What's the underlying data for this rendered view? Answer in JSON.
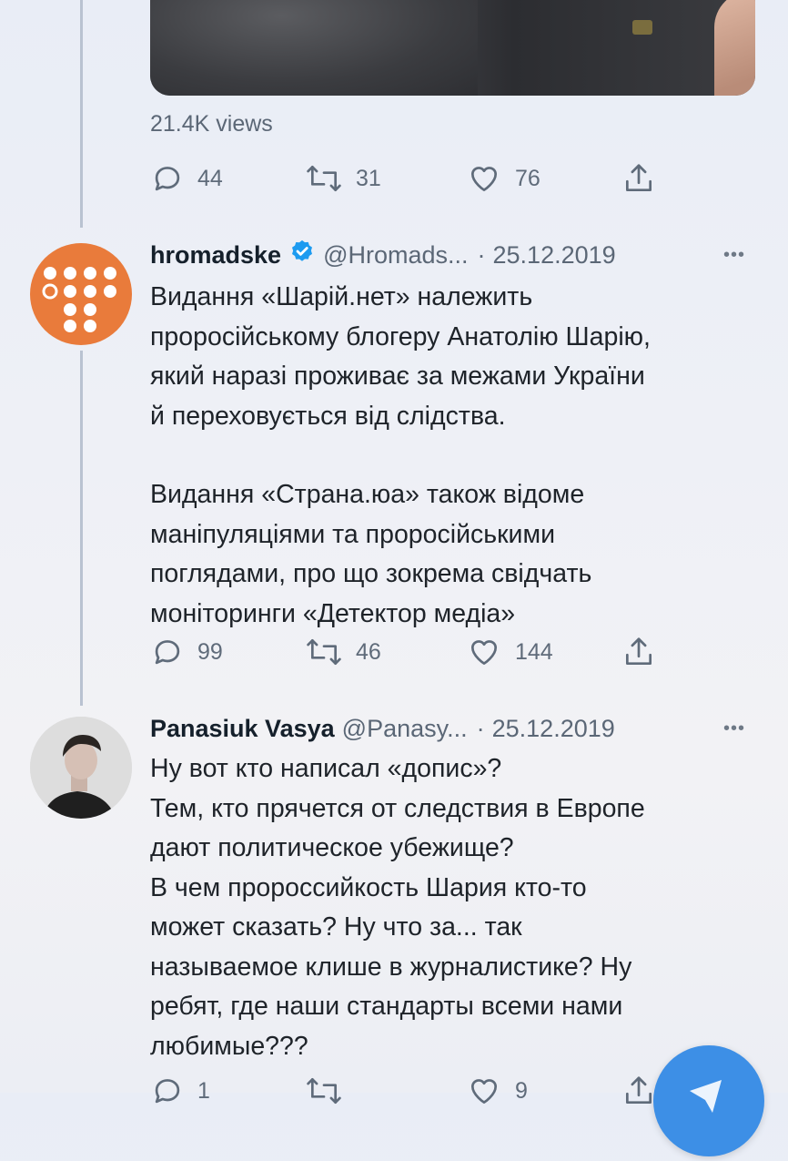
{
  "top_tweet": {
    "views": "21.4K views",
    "replies": "44",
    "retweets": "31",
    "likes": "76"
  },
  "tweets": [
    {
      "name": "hromadske",
      "handle": "@Hromads...",
      "sep": "·",
      "date": "25.12.2019",
      "more": "•••",
      "paragraphs": [
        [
          "Видання «Шарій.нет» належить",
          "проросійському блогеру Анатолію Шарію,",
          "який наразі проживає за межами України",
          "й переховується від слідства."
        ],
        [
          "Видання «Страна.юа» також відоме",
          "маніпуляціями та проросійськими",
          "поглядами, про що зокрема свідчать",
          "моніторинги «Детектор медіа»"
        ]
      ],
      "replies": "99",
      "retweets": "46",
      "likes": "144"
    },
    {
      "name": "Panasiuk Vasya",
      "handle": "@Panasy...",
      "sep": "·",
      "date": "25.12.2019",
      "more": "•••",
      "lines": [
        "Ну вот кто написал «допис»?",
        "Тем, кто прячется от следствия в Европе",
        "дают политическое убежище?",
        "В чем пророссийкость Шария кто-то",
        "может сказать? Ну что за... так",
        "называемое клише в журналистике? Ну",
        "ребят, где наши стандарты всеми нами",
        "любимые???"
      ],
      "replies": "1",
      "likes": "9"
    }
  ],
  "colors": {
    "accent": "#1d9bf0",
    "verified": "#1d9bf0",
    "hromadske_orange": "#e97b3b",
    "fab": "#3d8fe6"
  },
  "icons": [
    "reply-icon",
    "retweet-icon",
    "like-icon",
    "share-icon",
    "verified-badge-icon",
    "more-icon"
  ]
}
